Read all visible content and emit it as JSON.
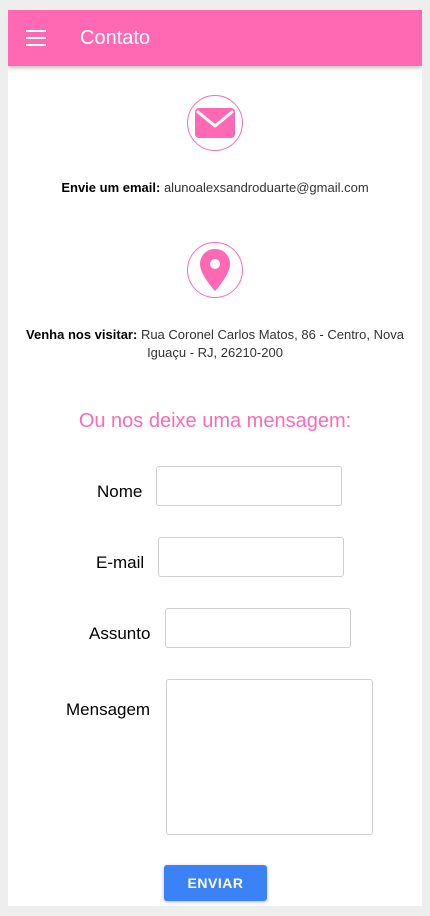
{
  "appbar": {
    "title": "Contato",
    "menu_icon": "hamburger-menu-icon"
  },
  "colors": {
    "accent": "#ff69b4",
    "button": "#3b82f6"
  },
  "email_section": {
    "icon": "envelope-icon",
    "label": "Envie um email:",
    "value": "alunoalexsandroduarte@gmail.com"
  },
  "address_section": {
    "icon": "map-pin-icon",
    "label": "Venha nos visitar:",
    "value_line1": "Rua Coronel Carlos Matos, 86 - Centro, Nova",
    "value_line2": "Iguaçu - RJ, 26210-200"
  },
  "form": {
    "heading": "Ou nos deixe uma mensagem:",
    "fields": {
      "nome": {
        "label": "Nome",
        "value": ""
      },
      "email": {
        "label": "E-mail",
        "value": ""
      },
      "assunto": {
        "label": "Assunto",
        "value": ""
      },
      "mensagem": {
        "label": "Mensagem",
        "value": ""
      }
    },
    "submit_label": "ENVIAR"
  }
}
